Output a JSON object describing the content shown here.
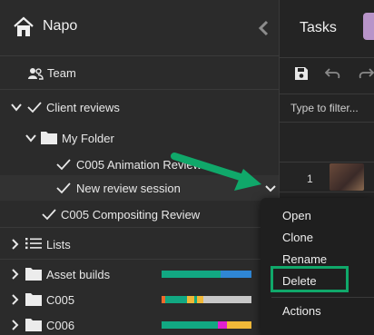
{
  "sidebar": {
    "app_name": "Napo",
    "team_label": "Team",
    "tree": {
      "client_reviews": "Client reviews",
      "my_folder": "My Folder",
      "animation_review": "C005 Animation Review",
      "new_review_session": "New review session",
      "compositing_review": "C005 Compositing Review"
    },
    "lists_label": "Lists",
    "projects": [
      {
        "name": "Asset builds"
      },
      {
        "name": "C005"
      },
      {
        "name": "C006"
      }
    ]
  },
  "panel": {
    "title": "Tasks",
    "filter_placeholder": "Type to filter...",
    "row_number": "1"
  },
  "context_menu": {
    "items": [
      "Open",
      "Clone",
      "Rename",
      "Delete",
      "Actions"
    ]
  },
  "colors": {
    "annotation_green": "#10a86a",
    "bar_green": "#12a882",
    "bar_blue": "#2f86d4",
    "bar_gray": "#c8c8c8",
    "bar_orange": "#f06a2a",
    "bar_yellow": "#f0b838",
    "bar_magenta": "#e020d0"
  },
  "icons": [
    "home-icon",
    "collapse-chevron-icon",
    "team-icon",
    "check-icon",
    "folder-icon",
    "chevron-down-icon",
    "chevron-right-icon",
    "list-icon",
    "save-icon",
    "undo-icon",
    "redo-icon",
    "arrow-annotation"
  ]
}
